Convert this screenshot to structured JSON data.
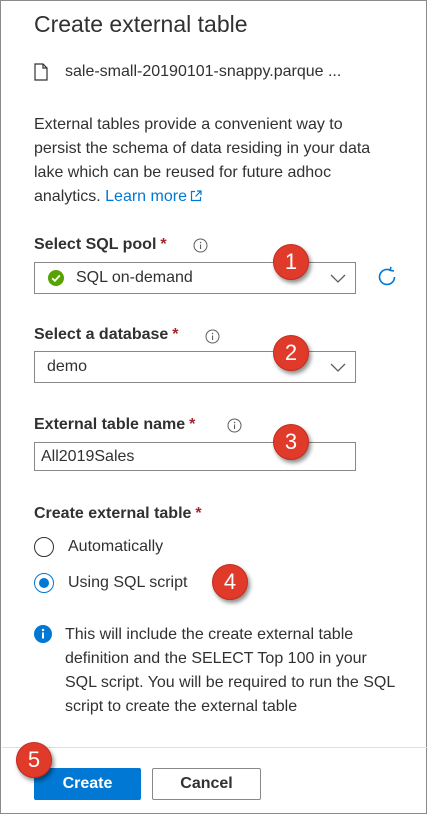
{
  "panel": {
    "title": "Create external table",
    "file_name": "sale-small-20190101-snappy.parque ...",
    "description": "External tables provide a convenient way to persist the schema of data residing in your data lake which can be reused for future adhoc analytics.",
    "learn_more": "Learn more"
  },
  "sql_pool": {
    "label": "Select SQL pool",
    "required": "*",
    "value": "SQL on-demand",
    "status_icon": "check-circle-icon",
    "refresh_icon": "refresh-icon"
  },
  "database": {
    "label": "Select a database",
    "required": "*",
    "value": "demo"
  },
  "table_name": {
    "label": "External table name",
    "required": "*",
    "value": "All2019Sales"
  },
  "create_method": {
    "label": "Create external table",
    "required": "*",
    "options": [
      {
        "label": "Automatically",
        "checked": false
      },
      {
        "label": "Using SQL script",
        "checked": true
      }
    ]
  },
  "note": {
    "text": "This will include the create external table definition and the SELECT Top 100 in your SQL script. You will be required to run the SQL script to create the external table"
  },
  "buttons": {
    "create": "Create",
    "cancel": "Cancel"
  },
  "callouts": [
    "1",
    "2",
    "3",
    "4",
    "5"
  ],
  "colors": {
    "accent": "#0078d4",
    "success": "#57a300",
    "required": "#a4262c",
    "callout": "#e03a2b"
  }
}
